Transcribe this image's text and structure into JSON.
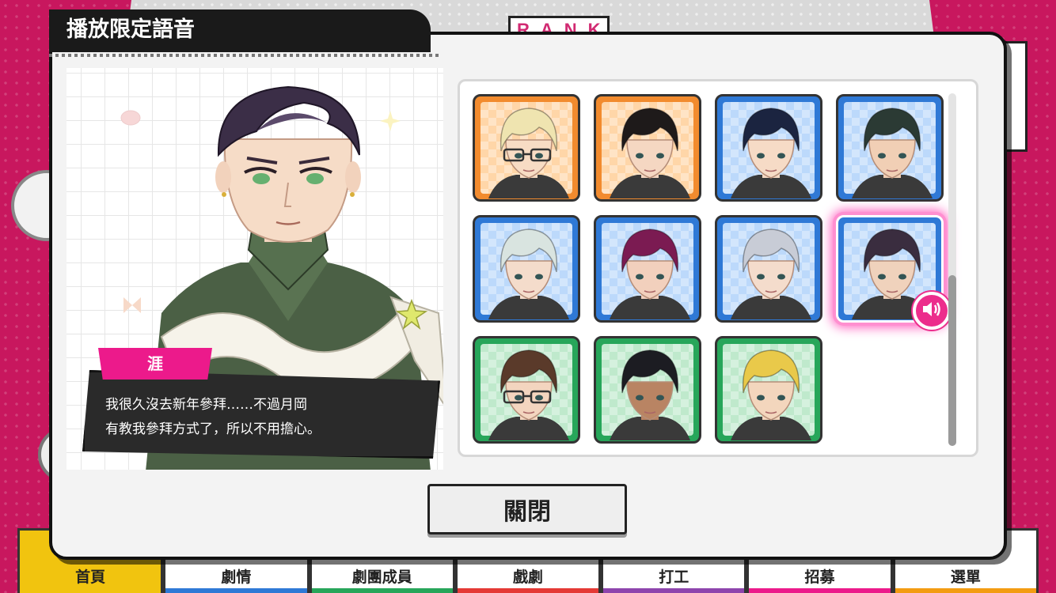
{
  "dialog": {
    "title": "播放限定語音",
    "close_label": "關閉"
  },
  "character": {
    "name": "涯",
    "line1": "我很久沒去新年參拜……不過月岡",
    "line2": "有教我參拜方式了，所以不用擔心。"
  },
  "background": {
    "rank_badge": "RANK"
  },
  "grid": {
    "cards": [
      {
        "color": "orange",
        "hair": "#efe4b0",
        "skin": "#f7dcc4",
        "glasses": true,
        "selected": false
      },
      {
        "color": "orange",
        "hair": "#1e1a1a",
        "skin": "#f5d7c2",
        "glasses": false,
        "selected": false
      },
      {
        "color": "blue",
        "hair": "#1b2440",
        "skin": "#f6dbc6",
        "glasses": false,
        "selected": false
      },
      {
        "color": "blue",
        "hair": "#2b3a34",
        "skin": "#f1cfb5",
        "glasses": false,
        "selected": false
      },
      {
        "color": "blue",
        "hair": "#d9e4e0",
        "skin": "#f4dccb",
        "glasses": false,
        "selected": false
      },
      {
        "color": "blue",
        "hair": "#7b1b52",
        "skin": "#f2d0bd",
        "glasses": false,
        "selected": false
      },
      {
        "color": "blue",
        "hair": "#c8ccd6",
        "skin": "#f4dccc",
        "glasses": false,
        "selected": false
      },
      {
        "color": "blue",
        "hair": "#3a2d3f",
        "skin": "#f0d2bc",
        "glasses": false,
        "selected": true
      },
      {
        "color": "green",
        "hair": "#5a3a2a",
        "skin": "#f3d5bf",
        "glasses": true,
        "selected": false
      },
      {
        "color": "green",
        "hair": "#1c1c22",
        "skin": "#b98463",
        "glasses": false,
        "selected": false
      },
      {
        "color": "green",
        "hair": "#e9c94a",
        "skin": "#f3d6bd",
        "glasses": false,
        "selected": false
      }
    ],
    "selected_icon": "speaker-icon"
  },
  "bottom_nav": {
    "tabs": [
      {
        "label": "首頁",
        "color": "#f1c40f"
      },
      {
        "label": "劇情",
        "color": "#2f79d6"
      },
      {
        "label": "劇團成員",
        "color": "#27a65a"
      },
      {
        "label": "戲劇",
        "color": "#e53935"
      },
      {
        "label": "打工",
        "color": "#8e44ad"
      },
      {
        "label": "招募",
        "color": "#ec1a8b"
      },
      {
        "label": "選單",
        "color": "#f39c12"
      }
    ]
  }
}
